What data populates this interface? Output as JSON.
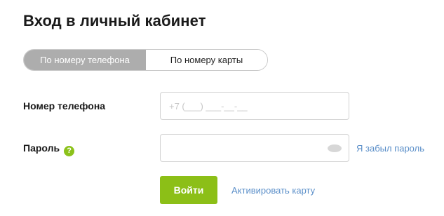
{
  "page": {
    "title": "Вход в личный кабинет"
  },
  "tabs": [
    {
      "label": "По номеру телефона",
      "active": true
    },
    {
      "label": "По номеру карты",
      "active": false
    }
  ],
  "phone": {
    "label": "Номер телефона",
    "placeholder": "+7 (___) ___-__-__",
    "value": ""
  },
  "password": {
    "label": "Пароль",
    "help_icon": "question-icon",
    "help_glyph": "?",
    "value": "",
    "toggle_icon": "eye-icon",
    "forgot_link": "Я забыл пароль"
  },
  "actions": {
    "login_label": "Войти",
    "activate_link": "Активировать карту"
  },
  "colors": {
    "accent_green": "#8cbf17",
    "link_blue": "#5b8fc9",
    "tab_active_bg": "#adadad"
  }
}
